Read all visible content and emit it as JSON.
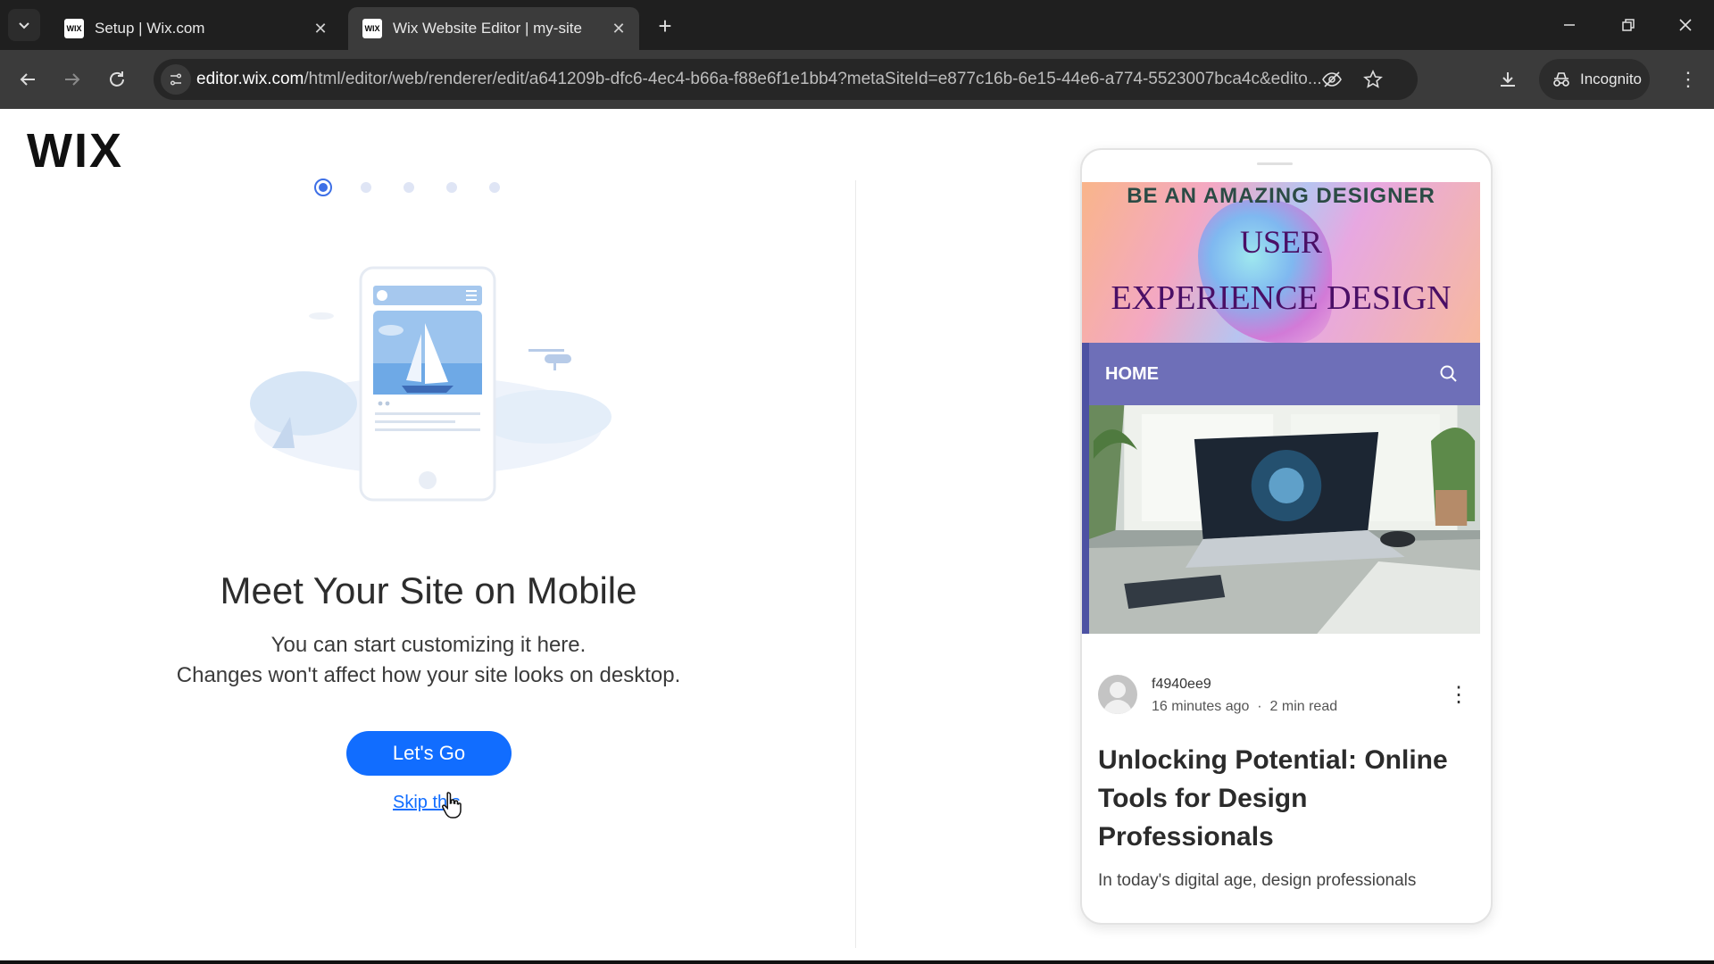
{
  "browser": {
    "tabs": [
      {
        "favicon": "WIX",
        "title": "Setup | Wix.com"
      },
      {
        "favicon": "WIX",
        "title": "Wix Website Editor | my-site"
      }
    ],
    "url_host": "editor.wix.com",
    "url_rest": "/html/editor/web/renderer/edit/a641209b-dfc6-4ec4-b66a-f88e6f1e1bb4?metaSiteId=e877c16b-6e15-44e6-a774-5523007bca4c&edito...",
    "incognito_label": "Incognito"
  },
  "page": {
    "logo": "WIX",
    "heading": "Meet Your Site on Mobile",
    "subtext_line1": "You can start customizing it here.",
    "subtext_line2": "Changes won't affect how your site looks on desktop.",
    "primary_button": "Let's Go",
    "skip_link": "Skip this",
    "onboarding_step": {
      "current": 1,
      "total": 5
    }
  },
  "preview": {
    "banner_line1": "BE AN AMAZING DESIGNER",
    "banner_line2": "USER",
    "banner_line3": "EXPERIENCE DESIGN",
    "menu_home": "HOME",
    "post": {
      "author": "f4940ee9",
      "time": "16 minutes ago",
      "read": "2 min read",
      "title": "Unlocking Potential: Online Tools for Design Professionals",
      "excerpt": "In today's digital age, design professionals"
    }
  },
  "colors": {
    "primary_button": "#116dff",
    "menu_bar": "#6e6fb8",
    "banner_text": "#4a0f66"
  }
}
